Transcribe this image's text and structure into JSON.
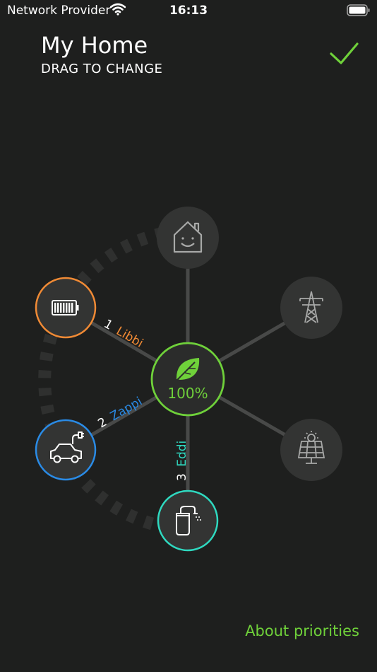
{
  "status_bar": {
    "carrier": "Network Provider",
    "time": "16:13"
  },
  "header": {
    "title": "My Home",
    "subtitle": "DRAG TO CHANGE"
  },
  "hub": {
    "percent": "100%",
    "icon": "leaf-icon"
  },
  "devices": [
    {
      "rank": "1",
      "name": "Libbi",
      "icon": "battery-icon",
      "color": "#f08a35"
    },
    {
      "rank": "2",
      "name": "Zappi",
      "icon": "ev-car-icon",
      "color": "#2a8be6"
    },
    {
      "rank": "3",
      "name": "Eddi",
      "icon": "water-heater-icon",
      "color": "#2fd9c0"
    }
  ],
  "sources": [
    {
      "icon": "home-icon"
    },
    {
      "icon": "grid-pylon-icon"
    },
    {
      "icon": "solar-panel-icon"
    }
  ],
  "colors": {
    "background": "#1e1f1e",
    "accent_green": "#6fd13a",
    "node_grey": "#333433"
  },
  "footer": {
    "about_link": "About priorities"
  }
}
